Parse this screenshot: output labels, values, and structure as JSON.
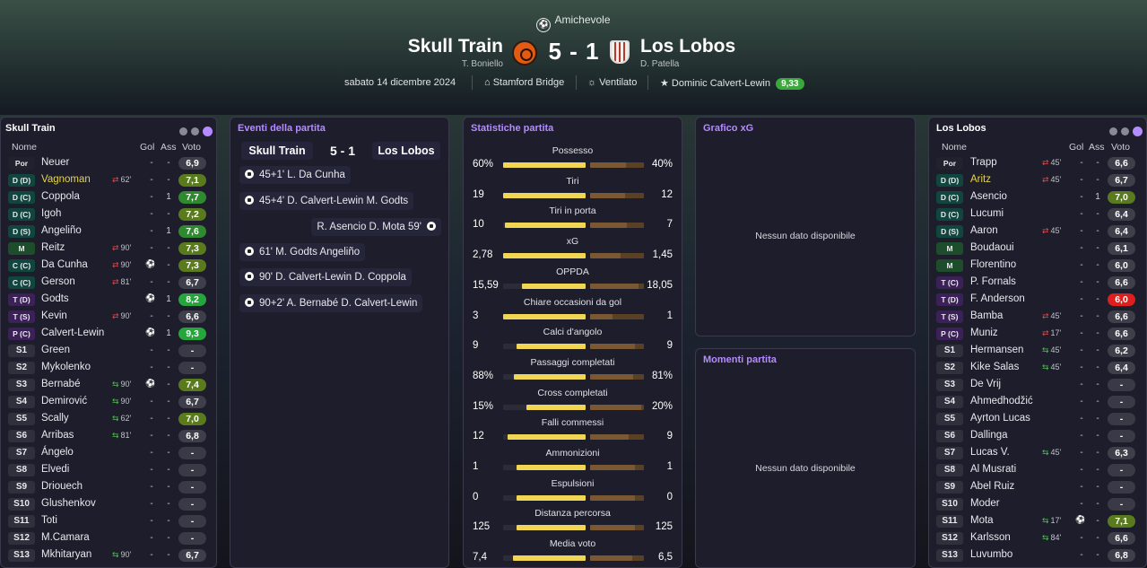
{
  "match": {
    "competition": "Amichevole",
    "home_team": "Skull Train",
    "home_manager": "T. Boniello",
    "away_team": "Los Lobos",
    "away_manager": "D. Patella",
    "score": "5 - 1",
    "date": "sabato 14 dicembre 2024",
    "stadium": "Stamford Bridge",
    "weather": "Ventilato",
    "motm": "Dominic Calvert-Lewin",
    "motm_rating": "9,33"
  },
  "lineup_headers": {
    "name": "Nome",
    "gol": "Gol",
    "ass": "Ass",
    "vote": "Voto"
  },
  "home_lineup": {
    "title": "Skull Train",
    "players": [
      {
        "pos": "Por",
        "name": "Neuer",
        "sub": "",
        "gol": "-",
        "ass": "-",
        "vote": "6,9"
      },
      {
        "pos": "D (D)",
        "name": "Vagnoman",
        "sub": "62'",
        "sub_dir": "out",
        "gol": "-",
        "ass": "-",
        "vote": "7,1",
        "highlight": true
      },
      {
        "pos": "D (C)",
        "name": "Coppola",
        "sub": "",
        "gol": "-",
        "ass": "1",
        "vote": "7,7"
      },
      {
        "pos": "D (C)",
        "name": "Igoh",
        "sub": "",
        "gol": "-",
        "ass": "-",
        "vote": "7,2"
      },
      {
        "pos": "D (S)",
        "name": "Angeliño",
        "sub": "",
        "gol": "-",
        "ass": "1",
        "vote": "7,6"
      },
      {
        "pos": "M",
        "name": "Reitz",
        "sub": "90'",
        "sub_dir": "out",
        "gol": "-",
        "ass": "-",
        "vote": "7,3"
      },
      {
        "pos": "C (C)",
        "name": "Da Cunha",
        "sub": "90'",
        "sub_dir": "out",
        "goal_icon": true,
        "gol": "",
        "ass": "-",
        "vote": "7,3"
      },
      {
        "pos": "C (C)",
        "name": "Gerson",
        "sub": "81'",
        "sub_dir": "out",
        "gol": "-",
        "ass": "-",
        "vote": "6,7"
      },
      {
        "pos": "T (D)",
        "name": "Godts",
        "sub": "",
        "goal_icon": true,
        "gol": "",
        "ass": "1",
        "vote": "8,2"
      },
      {
        "pos": "T (S)",
        "name": "Kevin",
        "sub": "90'",
        "sub_dir": "out",
        "gol": "-",
        "ass": "-",
        "vote": "6,6"
      },
      {
        "pos": "P (C)",
        "name": "Calvert-Lewin",
        "sub": "",
        "goal_icon": true,
        "gol": "",
        "ass": "1",
        "vote": "9,3"
      },
      {
        "pos": "S1",
        "name": "Green",
        "sub": "",
        "gol": "-",
        "ass": "-",
        "vote": "-"
      },
      {
        "pos": "S2",
        "name": "Mykolenko",
        "sub": "",
        "gol": "-",
        "ass": "-",
        "vote": "-"
      },
      {
        "pos": "S3",
        "name": "Bernabé",
        "sub": "90'",
        "sub_dir": "in",
        "goal_icon": true,
        "gol": "",
        "ass": "-",
        "vote": "7,4"
      },
      {
        "pos": "S4",
        "name": "Demirović",
        "sub": "90'",
        "sub_dir": "in",
        "gol": "-",
        "ass": "-",
        "vote": "6,7"
      },
      {
        "pos": "S5",
        "name": "Scally",
        "sub": "62'",
        "sub_dir": "in",
        "gol": "-",
        "ass": "-",
        "vote": "7,0"
      },
      {
        "pos": "S6",
        "name": "Arribas",
        "sub": "81'",
        "sub_dir": "in",
        "gol": "-",
        "ass": "-",
        "vote": "6,8"
      },
      {
        "pos": "S7",
        "name": "Ángelo",
        "sub": "",
        "gol": "-",
        "ass": "-",
        "vote": "-"
      },
      {
        "pos": "S8",
        "name": "Elvedi",
        "sub": "",
        "gol": "-",
        "ass": "-",
        "vote": "-"
      },
      {
        "pos": "S9",
        "name": "Driouech",
        "sub": "",
        "gol": "-",
        "ass": "-",
        "vote": "-"
      },
      {
        "pos": "S10",
        "name": "Glushenkov",
        "sub": "",
        "gol": "-",
        "ass": "-",
        "vote": "-"
      },
      {
        "pos": "S11",
        "name": "Toti",
        "sub": "",
        "gol": "-",
        "ass": "-",
        "vote": "-"
      },
      {
        "pos": "S12",
        "name": "M.Camara",
        "sub": "",
        "gol": "-",
        "ass": "-",
        "vote": "-"
      },
      {
        "pos": "S13",
        "name": "Mkhitaryan",
        "sub": "90'",
        "sub_dir": "in",
        "gol": "-",
        "ass": "-",
        "vote": "6,7"
      }
    ]
  },
  "away_lineup": {
    "title": "Los Lobos",
    "players": [
      {
        "pos": "Por",
        "name": "Trapp",
        "sub": "45'",
        "sub_dir": "out",
        "gol": "-",
        "ass": "-",
        "vote": "6,6"
      },
      {
        "pos": "D (D)",
        "name": "Aritz",
        "sub": "45'",
        "sub_dir": "out",
        "gol": "-",
        "ass": "-",
        "vote": "6,7",
        "highlight": true
      },
      {
        "pos": "D (C)",
        "name": "Asencio",
        "sub": "",
        "gol": "-",
        "ass": "1",
        "vote": "7,0"
      },
      {
        "pos": "D (C)",
        "name": "Lucumi",
        "sub": "",
        "gol": "-",
        "ass": "-",
        "vote": "6,4"
      },
      {
        "pos": "D (S)",
        "name": "Aaron",
        "sub": "45'",
        "sub_dir": "out",
        "gol": "-",
        "ass": "-",
        "vote": "6,4"
      },
      {
        "pos": "M",
        "name": "Boudaoui",
        "sub": "",
        "gol": "-",
        "ass": "-",
        "vote": "6,1"
      },
      {
        "pos": "M",
        "name": "Florentino",
        "sub": "",
        "gol": "-",
        "ass": "-",
        "vote": "6,0"
      },
      {
        "pos": "T (C)",
        "name": "P. Fornals",
        "sub": "",
        "gol": "-",
        "ass": "-",
        "vote": "6,6"
      },
      {
        "pos": "T (D)",
        "name": "F. Anderson",
        "sub": "",
        "gol": "-",
        "ass": "-",
        "vote": "6,0",
        "red": true
      },
      {
        "pos": "T (S)",
        "name": "Bamba",
        "sub": "45'",
        "sub_dir": "out",
        "gol": "-",
        "ass": "-",
        "vote": "6,6"
      },
      {
        "pos": "P (C)",
        "name": "Muniz",
        "sub": "17'",
        "sub_dir": "out",
        "gol": "-",
        "ass": "-",
        "vote": "6,6"
      },
      {
        "pos": "S1",
        "name": "Hermansen",
        "sub": "45'",
        "sub_dir": "in",
        "gol": "-",
        "ass": "-",
        "vote": "6,2"
      },
      {
        "pos": "S2",
        "name": "Kike Salas",
        "sub": "45'",
        "sub_dir": "in",
        "gol": "-",
        "ass": "-",
        "vote": "6,4"
      },
      {
        "pos": "S3",
        "name": "De Vrij",
        "sub": "",
        "gol": "-",
        "ass": "-",
        "vote": "-"
      },
      {
        "pos": "S4",
        "name": "Ahmedhodžić",
        "sub": "",
        "gol": "-",
        "ass": "-",
        "vote": "-"
      },
      {
        "pos": "S5",
        "name": "Ayrton Lucas",
        "sub": "",
        "gol": "-",
        "ass": "-",
        "vote": "-"
      },
      {
        "pos": "S6",
        "name": "Dallinga",
        "sub": "",
        "gol": "-",
        "ass": "-",
        "vote": "-"
      },
      {
        "pos": "S7",
        "name": "Lucas V.",
        "sub": "45'",
        "sub_dir": "in",
        "gol": "-",
        "ass": "-",
        "vote": "6,3"
      },
      {
        "pos": "S8",
        "name": "Al Musrati",
        "sub": "",
        "gol": "-",
        "ass": "-",
        "vote": "-"
      },
      {
        "pos": "S9",
        "name": "Abel Ruiz",
        "sub": "",
        "gol": "-",
        "ass": "-",
        "vote": "-"
      },
      {
        "pos": "S10",
        "name": "Moder",
        "sub": "",
        "gol": "-",
        "ass": "-",
        "vote": "-"
      },
      {
        "pos": "S11",
        "name": "Mota",
        "sub": "17'",
        "sub_dir": "in",
        "goal_icon": true,
        "gol": "",
        "ass": "-",
        "vote": "7,1"
      },
      {
        "pos": "S12",
        "name": "Karlsson",
        "sub": "84'",
        "sub_dir": "in",
        "gol": "-",
        "ass": "-",
        "vote": "6,6"
      },
      {
        "pos": "S13",
        "name": "Luvumbo",
        "sub": "",
        "gol": "-",
        "ass": "-",
        "vote": "6,8"
      }
    ]
  },
  "events": {
    "title": "Eventi della partita",
    "home_team": "Skull Train",
    "score": "5 - 1",
    "away_team": "Los Lobos",
    "items": [
      {
        "side": "home",
        "text": "45+1'  L. Da Cunha"
      },
      {
        "side": "home",
        "text": "45+4'  D. Calvert-Lewin  M. Godts"
      },
      {
        "side": "away",
        "text": "R. Asencio  D. Mota  59'"
      },
      {
        "side": "home",
        "text": "61'  M. Godts  Angeliño"
      },
      {
        "side": "home",
        "text": "90'  D. Calvert-Lewin  D. Coppola"
      },
      {
        "side": "home",
        "text": "90+2'  A. Bernabé  D. Calvert-Lewin"
      }
    ]
  },
  "stats": {
    "title": "Statistiche partita",
    "items": [
      {
        "label": "Possesso",
        "home": "60%",
        "away": "40%",
        "home_frac": 0.6,
        "away_frac": 0.4
      },
      {
        "label": "Tiri",
        "home": "19",
        "away": "12",
        "home_frac": 0.61,
        "away_frac": 0.39
      },
      {
        "label": "Tiri in porta",
        "home": "10",
        "away": "7",
        "home_frac": 0.59,
        "away_frac": 0.41
      },
      {
        "label": "xG",
        "home": "2,78",
        "away": "1,45",
        "home_frac": 0.66,
        "away_frac": 0.34
      },
      {
        "label": "OPPDA",
        "home": "15,59",
        "away": "18,05",
        "home_frac": 0.46,
        "away_frac": 0.54
      },
      {
        "label": "Chiare occasioni da gol",
        "home": "3",
        "away": "1",
        "home_frac": 0.75,
        "away_frac": 0.25
      },
      {
        "label": "Calci d'angolo",
        "home": "9",
        "away": "9",
        "home_frac": 0.5,
        "away_frac": 0.5
      },
      {
        "label": "Passaggi completati",
        "home": "88%",
        "away": "81%",
        "home_frac": 0.52,
        "away_frac": 0.48
      },
      {
        "label": "Cross completati",
        "home": "15%",
        "away": "20%",
        "home_frac": 0.43,
        "away_frac": 0.57
      },
      {
        "label": "Falli commessi",
        "home": "12",
        "away": "9",
        "home_frac": 0.57,
        "away_frac": 0.43
      },
      {
        "label": "Ammonizioni",
        "home": "1",
        "away": "1",
        "home_frac": 0.5,
        "away_frac": 0.5
      },
      {
        "label": "Espulsioni",
        "home": "0",
        "away": "0",
        "home_frac": 0.5,
        "away_frac": 0.5
      },
      {
        "label": "Distanza percorsa",
        "home": "125",
        "away": "125",
        "home_frac": 0.5,
        "away_frac": 0.5
      },
      {
        "label": "Media voto",
        "home": "7,4",
        "away": "6,5",
        "home_frac": 0.53,
        "away_frac": 0.47
      }
    ]
  },
  "xg_chart": {
    "title": "Grafico xG",
    "empty": "Nessun dato disponibile"
  },
  "moments": {
    "title": "Momenti partita",
    "empty": "Nessun dato disponibile"
  },
  "colors": {
    "accent": "#b48cff",
    "bar_home": "#f0d653",
    "bar_away": "#7a5834"
  }
}
